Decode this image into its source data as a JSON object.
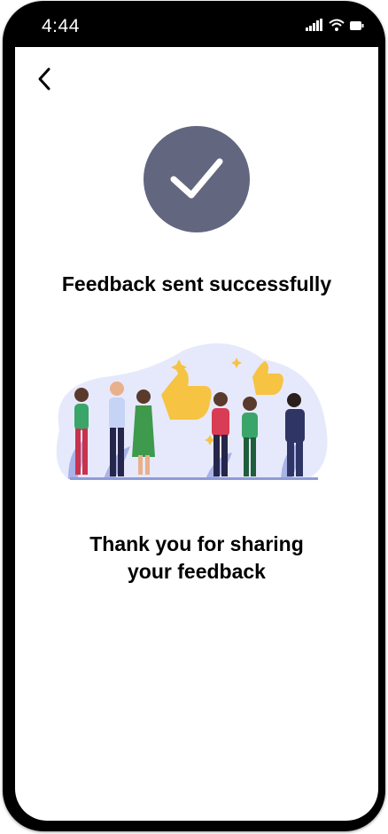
{
  "status_bar": {
    "time": "4:44",
    "icons": [
      "signal-icon",
      "wifi-icon",
      "battery-icon"
    ]
  },
  "nav": {
    "back_icon": "chevron-left-icon"
  },
  "success": {
    "icon": "checkmark-icon",
    "badge_color": "#62667f",
    "headline": "Feedback sent successfully"
  },
  "illustration": {
    "name": "people-celebrating-thumbs-up-illustration"
  },
  "message": {
    "line1": "Thank you for sharing",
    "line2": "your feedback"
  }
}
